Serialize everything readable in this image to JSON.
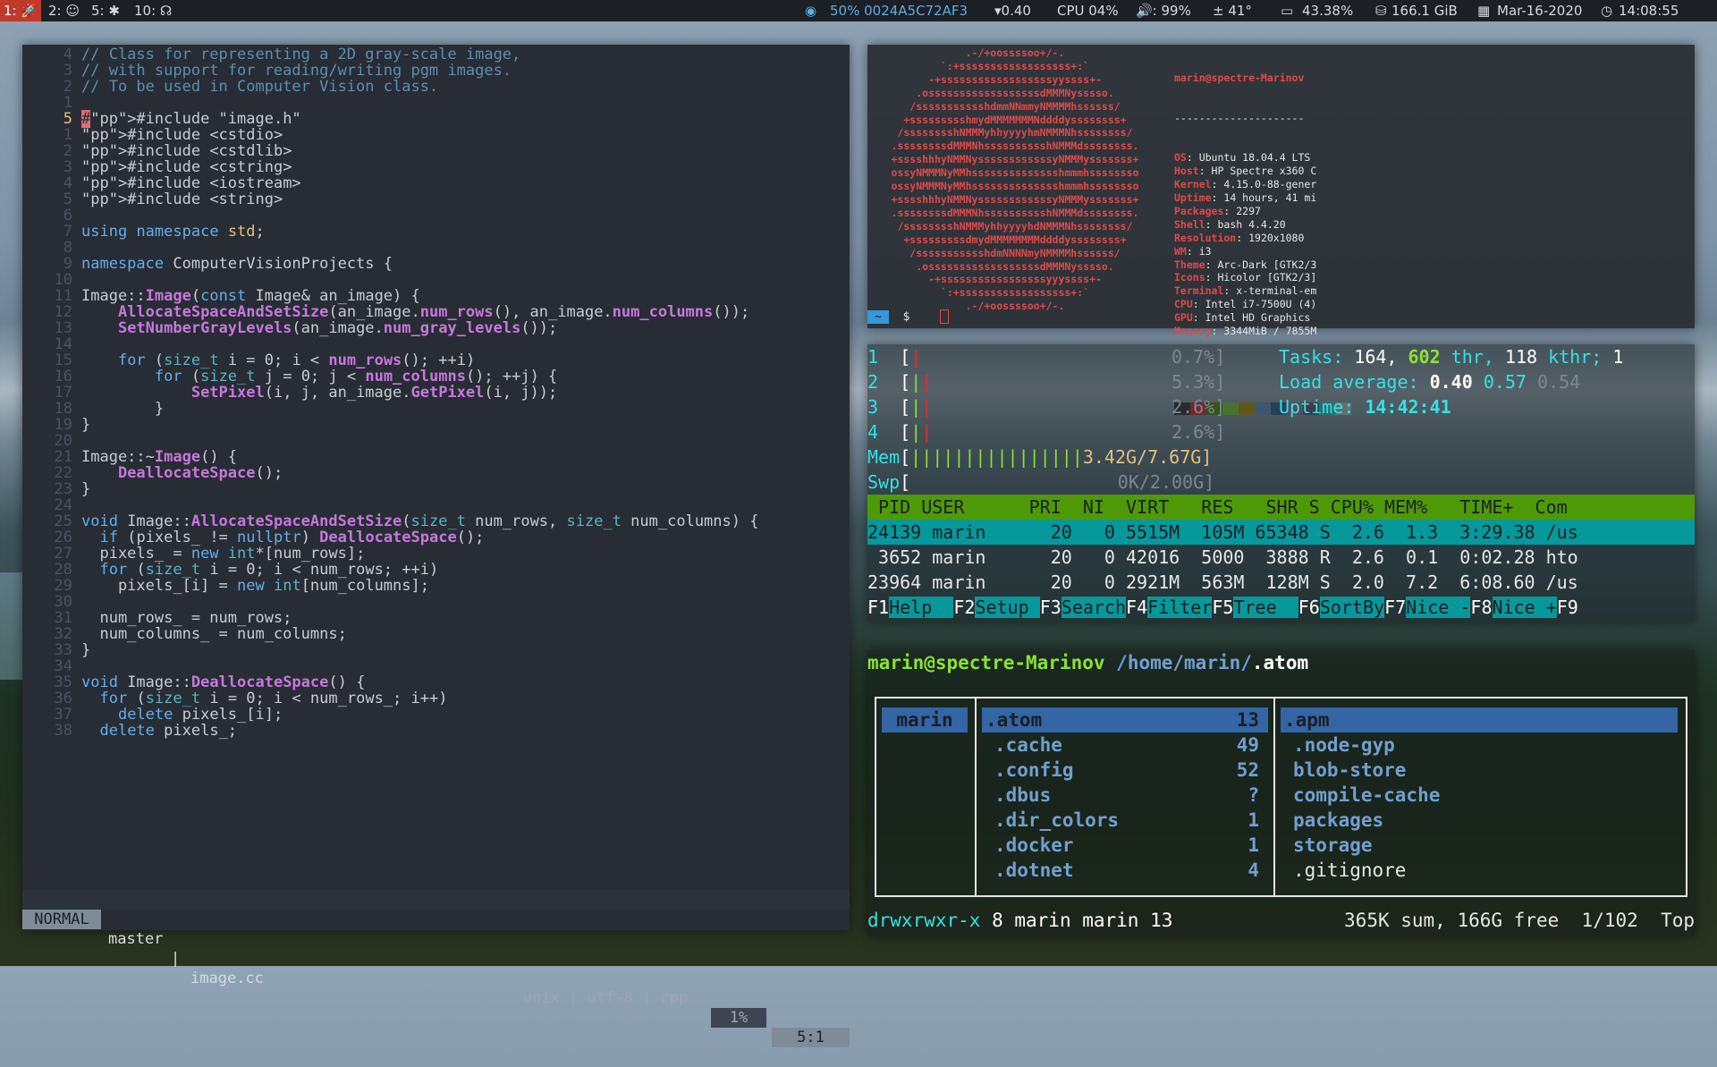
{
  "bar": {
    "workspaces": [
      {
        "label": "1: 🚀",
        "active": true
      },
      {
        "label": "2: ☺"
      },
      {
        "label": "5: ✱"
      },
      {
        "label": "10: ☊"
      }
    ],
    "wifi": "50% 0024A5C72AF3",
    "load": "▾0.40",
    "cpu": "CPU 04%",
    "volume": "🔊: 99%",
    "temp": "± 41°",
    "battery": "43.38%",
    "disk": "166.1 GiB",
    "date": "Mar-16-2020",
    "time": "14:08:55",
    "colors": {
      "bg": "#1c1f26",
      "active_ws": "#c0392b",
      "wifi": "#5dade2"
    }
  },
  "vim": {
    "lines": [
      {
        "n": "4",
        "t": "// Class for representing a 2D gray-scale image,"
      },
      {
        "n": "3",
        "t": "// with support for reading/writing pgm images."
      },
      {
        "n": "2",
        "t": "// To be used in Computer Vision class."
      },
      {
        "n": "1",
        "t": ""
      },
      {
        "n": "5",
        "t": "#include \"image.h\""
      },
      {
        "n": "1",
        "t": "#include <cstdio>"
      },
      {
        "n": "2",
        "t": "#include <cstdlib>"
      },
      {
        "n": "3",
        "t": "#include <cstring>"
      },
      {
        "n": "4",
        "t": "#include <iostream>"
      },
      {
        "n": "5",
        "t": "#include <string>"
      },
      {
        "n": "6",
        "t": ""
      },
      {
        "n": "7",
        "t": "using namespace std;"
      },
      {
        "n": "8",
        "t": ""
      },
      {
        "n": "9",
        "t": "namespace ComputerVisionProjects {"
      },
      {
        "n": "10",
        "t": ""
      },
      {
        "n": "11",
        "t": "Image::Image(const Image& an_image) {"
      },
      {
        "n": "12",
        "t": "    AllocateSpaceAndSetSize(an_image.num_rows(), an_image.num_columns());"
      },
      {
        "n": "13",
        "t": "    SetNumberGrayLevels(an_image.num_gray_levels());"
      },
      {
        "n": "14",
        "t": ""
      },
      {
        "n": "15",
        "t": "    for (size_t i = 0; i < num_rows(); ++i)"
      },
      {
        "n": "16",
        "t": "        for (size_t j = 0; j < num_columns(); ++j) {"
      },
      {
        "n": "17",
        "t": "            SetPixel(i, j, an_image.GetPixel(i, j));"
      },
      {
        "n": "18",
        "t": "        }"
      },
      {
        "n": "19",
        "t": "}"
      },
      {
        "n": "20",
        "t": ""
      },
      {
        "n": "21",
        "t": "Image::~Image() {"
      },
      {
        "n": "22",
        "t": "    DeallocateSpace();"
      },
      {
        "n": "23",
        "t": "}"
      },
      {
        "n": "24",
        "t": ""
      },
      {
        "n": "25",
        "t": "void Image::AllocateSpaceAndSetSize(size_t num_rows, size_t num_columns) {"
      },
      {
        "n": "26",
        "t": "  if (pixels_ != nullptr) DeallocateSpace();"
      },
      {
        "n": "27",
        "t": "  pixels_ = new int*[num_rows];"
      },
      {
        "n": "28",
        "t": "  for (size_t i = 0; i < num_rows; ++i)"
      },
      {
        "n": "29",
        "t": "    pixels_[i] = new int[num_columns];"
      },
      {
        "n": "30",
        "t": ""
      },
      {
        "n": "31",
        "t": "  num_rows_ = num_rows;"
      },
      {
        "n": "32",
        "t": "  num_columns_ = num_columns;"
      },
      {
        "n": "33",
        "t": "}"
      },
      {
        "n": "34",
        "t": ""
      },
      {
        "n": "35",
        "t": "void Image::DeallocateSpace() {"
      },
      {
        "n": "36",
        "t": "  for (size_t i = 0; i < num_rows_; i++)"
      },
      {
        "n": "37",
        "t": "    delete pixels_[i];"
      },
      {
        "n": "38",
        "t": "  delete pixels_;"
      }
    ],
    "status": {
      "mode": "NORMAL",
      "branch": "master",
      "file": "image.cc",
      "format": "unix | utf-8 | cpp",
      "percent": "1%",
      "pos": "5:1"
    }
  },
  "neofetch": {
    "ascii": [
      ".-/+oossssoo+/-.",
      "`:+ssssssssssssssssss+:`",
      "-+ssssssssssssssssssyyssss+-",
      ".ossssssssssssssssssdMMMNysssso.",
      "/ssssssssssshdmmNNmmyNMMMMhssssss/",
      "+ssssssssshmydMMMMMMMNddddyssssssss+",
      "/sssssssshNMMMyhhyyyyhmNMMMNhssssssss/",
      ".ssssssssdMMMNhsssssssssshNMMMdssssssss.",
      "+sssshhhyNMMNyssssssssssssyNMMMysssssss+",
      "ossyNMMMNyMMhsssssssssssssshmmmhssssssso",
      "ossyNMMMNyMMhsssssssssssssshmmmhssssssso",
      "+sssshhhyNMMNyssssssssssssyNMMMysssssss+",
      ".ssssssssdMMMNhsssssssssshNMMMdssssssss.",
      "/sssssssshNMMMyhhyyyyhdNMMMNhssssssss/",
      "+sssssssssdmydMMMMMMMMddddyssssssss+",
      "/ssssssssssshdmNNNNmyNMMMMhssssss/",
      ".ossssssssssssssssssdMMMNysssso.",
      "-+sssssssssssssssssyyyssss+-",
      "`:+ssssssssssssssssss+:`",
      ".-/+oossssoo+/-."
    ],
    "header": "marin@spectre-Marinov",
    "sep": "---------------------",
    "rows": [
      {
        "k": "OS",
        "v": "Ubuntu 18.04.4 LTS"
      },
      {
        "k": "Host",
        "v": "HP Spectre x360 C"
      },
      {
        "k": "Kernel",
        "v": "4.15.0-88-gener"
      },
      {
        "k": "Uptime",
        "v": "14 hours, 41 mi"
      },
      {
        "k": "Packages",
        "v": "2297"
      },
      {
        "k": "Shell",
        "v": "bash 4.4.20"
      },
      {
        "k": "Resolution",
        "v": "1920x1080"
      },
      {
        "k": "WM",
        "v": "i3"
      },
      {
        "k": "Theme",
        "v": "Arc-Dark [GTK2/3"
      },
      {
        "k": "Icons",
        "v": "Hicolor [GTK2/3]"
      },
      {
        "k": "Terminal",
        "v": "x-terminal-em"
      },
      {
        "k": "CPU",
        "v": "Intel i7-7500U (4)"
      },
      {
        "k": "GPU",
        "v": "Intel HD Graphics"
      },
      {
        "k": "Memory",
        "v": "3344MiB / 7855M"
      }
    ],
    "palette": [
      "#2e3436",
      "#ef2929",
      "#4e9a06",
      "#8ae234",
      "#c4a000",
      "#729fcf",
      "#3465a4",
      "#ad7fa8",
      "#75507b",
      "#34e2e2",
      "#d3d7cf"
    ],
    "prompt": "~",
    "prompt_symbol": "$"
  },
  "htop": {
    "cpus": [
      {
        "n": "1",
        "pct": "0.7%]"
      },
      {
        "n": "2",
        "pct": "5.3%]"
      },
      {
        "n": "3",
        "pct": "2.6%]"
      },
      {
        "n": "4",
        "pct": "2.6%]"
      }
    ],
    "mem_label": "Mem",
    "mem_bars": "||||||||||||||||",
    "mem": "3.42G/7.67G]",
    "swp_label": "Swp",
    "swp": "0K/2.00G]",
    "tasks_label": "Tasks:",
    "tasks": "164,",
    "thr": "602",
    "thr_label": "thr,",
    "kthr": "118",
    "kthr_label": "kthr;",
    "running": "1",
    "load_label": "Load average:",
    "load1": "0.40",
    "load5": "0.57",
    "load15": "0.54",
    "uptime_label": "Uptime:",
    "uptime": "14:42:41",
    "header": " PID USER      PRI  NI  VIRT   RES   SHR S CPU% MEM%   TIME+  Com",
    "rows": [
      "24139 marin      20   0 5515M  105M 65348 S  2.6  1.3  3:29.38 /us",
      " 3652 marin      20   0 42016  5000  3888 R  2.6  0.1  0:02.28 hto",
      "23964 marin      20   0 2921M  563M  128M S  2.0  7.2  6:08.60 /us"
    ],
    "fkeys": [
      {
        "k": "F1",
        "l": "Help  "
      },
      {
        "k": "F2",
        "l": "Setup "
      },
      {
        "k": "F3",
        "l": "Search"
      },
      {
        "k": "F4",
        "l": "Filter"
      },
      {
        "k": "F5",
        "l": "Tree  "
      },
      {
        "k": "F6",
        "l": "SortBy"
      },
      {
        "k": "F7",
        "l": "Nice -"
      },
      {
        "k": "F8",
        "l": "Nice +"
      },
      {
        "k": "F9",
        "l": ""
      }
    ]
  },
  "ranger": {
    "user_host": "marin@spectre-Marinov",
    "path": "/home/marin/",
    "current": ".atom",
    "parent": [
      "marin"
    ],
    "files": [
      {
        "name": ".atom",
        "count": "13"
      },
      {
        "name": ".cache",
        "count": "49"
      },
      {
        "name": ".config",
        "count": "52"
      },
      {
        "name": ".dbus",
        "count": "?"
      },
      {
        "name": ".dir_colors",
        "count": "1"
      },
      {
        "name": ".docker",
        "count": "1"
      },
      {
        "name": ".dotnet",
        "count": "4"
      }
    ],
    "preview": [
      ".apm",
      ".node-gyp",
      "blob-store",
      "compile-cache",
      "packages",
      "storage",
      ".gitignore"
    ],
    "perm": "drwxrwxr-x",
    "meta": "8 marin marin 13",
    "summary": "365K sum, 166G free",
    "pos": "1/102",
    "scroll": "Top"
  }
}
